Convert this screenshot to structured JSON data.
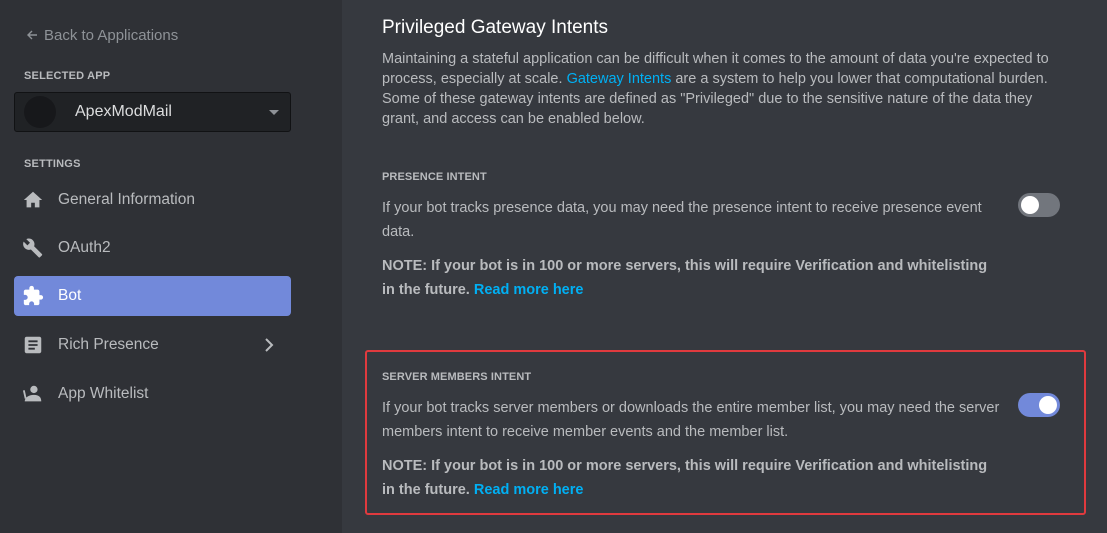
{
  "sidebar": {
    "back_label": "Back to Applications",
    "selected_app_heading": "SELECTED APP",
    "selected_app_name": "ApexModMail",
    "settings_heading": "SETTINGS",
    "items": [
      {
        "label": "General Information",
        "icon": "home-icon"
      },
      {
        "label": "OAuth2",
        "icon": "wrench-icon"
      },
      {
        "label": "Bot",
        "icon": "puzzle-icon",
        "active": true
      },
      {
        "label": "Rich Presence",
        "icon": "document-icon",
        "has_chevron": true
      },
      {
        "label": "App Whitelist",
        "icon": "user-icon"
      }
    ]
  },
  "main": {
    "title": "Privileged Gateway Intents",
    "intro_before_link": "Maintaining a stateful application can be difficult when it comes to the amount of data you're expected to process, especially at scale. ",
    "intro_link": "Gateway Intents",
    "intro_after_link": " are a system to help you lower that computational burden. Some of these gateway intents are defined as \"Privileged\" due to the sensitive nature of the data they grant, and access can be enabled below.",
    "intents": [
      {
        "title": "PRESENCE INTENT",
        "description": "If your bot tracks presence data, you may need the presence intent to receive presence event data.",
        "note": "NOTE: If your bot is in 100 or more servers, this will require Verification and whitelisting in the future.",
        "note_link": "Read more here",
        "enabled": false
      },
      {
        "title": "SERVER MEMBERS INTENT",
        "description": "If your bot tracks server members or downloads the entire member list, you may need the server members intent to receive member events and the member list.",
        "note": "NOTE: If your bot is in 100 or more servers, this will require Verification and whitelisting in the future.",
        "note_link": "Read more here",
        "enabled": true
      }
    ]
  },
  "colors": {
    "accent": "#7289da",
    "link": "#00b0f4",
    "highlight": "#e03a3e",
    "sidebar_bg": "#2f3136",
    "main_bg": "#36393f"
  }
}
